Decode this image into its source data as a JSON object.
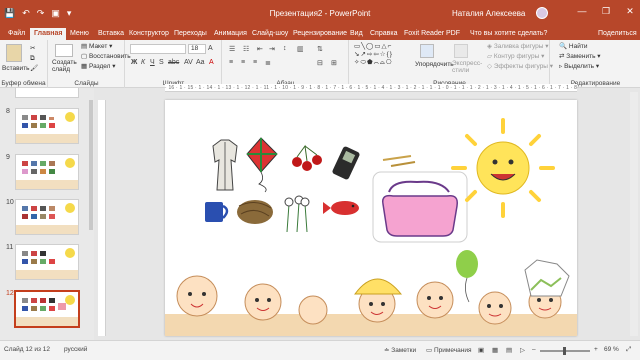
{
  "window": {
    "title": "Презентация2 - PowerPoint",
    "user": "Наталия Алексеева",
    "minimize": "—",
    "restore": "❐",
    "close": "✕"
  },
  "quick_access": {
    "save": "💾",
    "undo": "↶",
    "redo": "↷",
    "start": "▣",
    "customize": "▾"
  },
  "tabs": [
    {
      "label": "Файл"
    },
    {
      "label": "Главная"
    },
    {
      "label": "Меню"
    },
    {
      "label": "Вставка"
    },
    {
      "label": "Конструктор"
    },
    {
      "label": "Переходы"
    },
    {
      "label": "Анимация"
    },
    {
      "label": "Слайд-шоу"
    },
    {
      "label": "Рецензирование"
    },
    {
      "label": "Вид"
    },
    {
      "label": "Справка"
    },
    {
      "label": "Foxit Reader PDF"
    },
    {
      "label": "Что вы хотите сделать?"
    },
    {
      "label": "Поделиться"
    }
  ],
  "ribbon": {
    "clipboard": {
      "label": "Буфер обмена",
      "paste": "Вставить"
    },
    "slides": {
      "label": "Слайды",
      "new_slide": "Создать слайд",
      "layout": "Макет",
      "reset": "Восстановить",
      "section": "Раздел"
    },
    "font": {
      "label": "Шрифт",
      "font_name": "",
      "font_size": "18"
    },
    "paragraph": {
      "label": "Абзац"
    },
    "drawing": {
      "label": "Рисование",
      "arrange": "Упорядочить",
      "quick_styles": "Экспресс-стили",
      "shape_fill": "Заливка фигуры",
      "shape_outline": "Контур фигуры",
      "shape_effects": "Эффекты фигуры"
    },
    "editing": {
      "label": "Редактирование",
      "find": "Найти",
      "replace": "Заменить",
      "select": "Выделить"
    }
  },
  "thumbnails": [
    {
      "num": "8",
      "active": false
    },
    {
      "num": "9",
      "active": false
    },
    {
      "num": "10",
      "active": false
    },
    {
      "num": "11",
      "active": false
    },
    {
      "num": "12",
      "active": true
    }
  ],
  "ruler": {
    "horizontal": "· 16 · 1 · 15 · 1 · 14 · 1 · 13 · 1 · 12 · 1 · 11 · 1 · 10 · 1 · 9 · 1 · 8 · 1 · 7 · 1 · 6 · 1 · 5 · 1 · 4 · 1 · 3 · 1 · 2 · 1 · 1 · 1 · 0 · 1 · 1 · 1 · 2 · 1 · 3 · 1 · 4 · 1 · 5 · 1 · 6 · 1 · 7 · 1 · 8 · 1 · 9 · 1 · 10 · 1 · 11 · 1 · 12 · 1 · 13 · 1 · 14 · 1 · 15 · 1 · 16 ·"
  },
  "status": {
    "slide_info": "Слайд 12 из 12",
    "language": "русский",
    "notes": "Заметки",
    "comments": "Примечания",
    "zoom": "69 %",
    "zoom_level": 0.69
  },
  "colors": {
    "accent": "#b7472a",
    "active_thumb": "#c43e1c"
  }
}
